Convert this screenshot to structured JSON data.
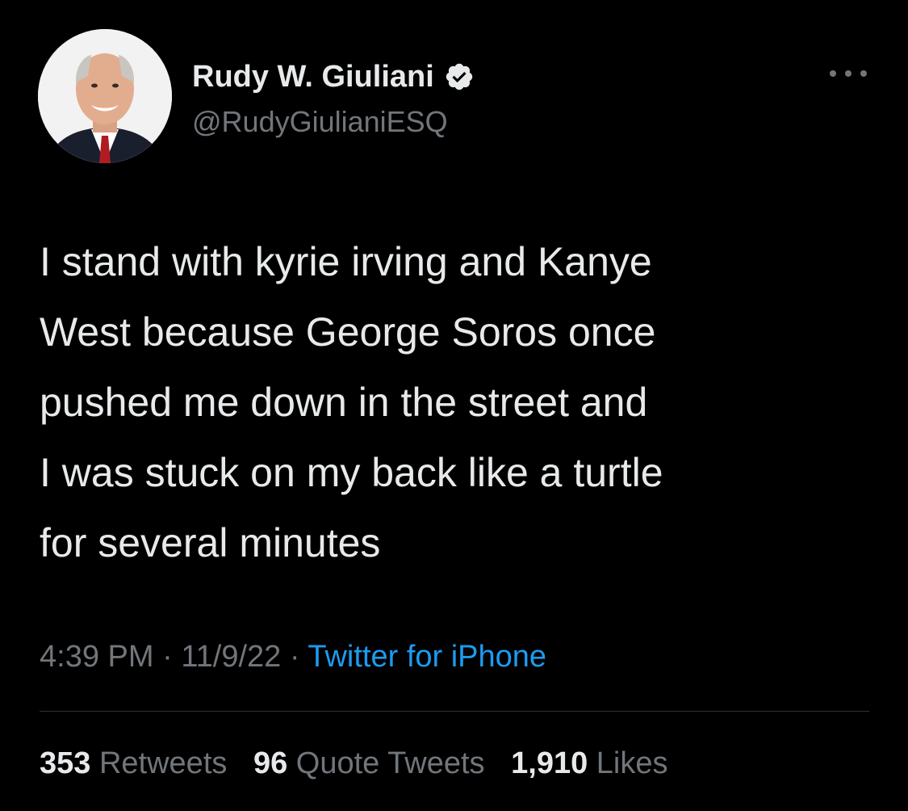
{
  "author": {
    "display_name": "Rudy W. Giuliani",
    "handle": "@RudyGiulianiESQ",
    "verified": true,
    "avatar_icon": "profile-photo"
  },
  "menu": {
    "more_icon": "more-horizontal-icon"
  },
  "tweet": {
    "text": "I stand with kyrie irving and Kanye\nWest because George Soros once\npushed me down in the street and\nI was stuck on my back like a turtle\nfor several minutes"
  },
  "meta": {
    "time": "4:39 PM",
    "separator": "·",
    "date": "11/9/22",
    "source": "Twitter for iPhone"
  },
  "stats": {
    "retweets": {
      "count": "353",
      "label": "Retweets"
    },
    "quotes": {
      "count": "96",
      "label": "Quote Tweets"
    },
    "likes": {
      "count": "1,910",
      "label": "Likes"
    }
  },
  "colors": {
    "background": "#000000",
    "text_primary": "#e7e9ea",
    "text_secondary": "#71767b",
    "link": "#1d9bf0",
    "verified_badge": "#e7e9ea",
    "divider": "#2f3336"
  }
}
